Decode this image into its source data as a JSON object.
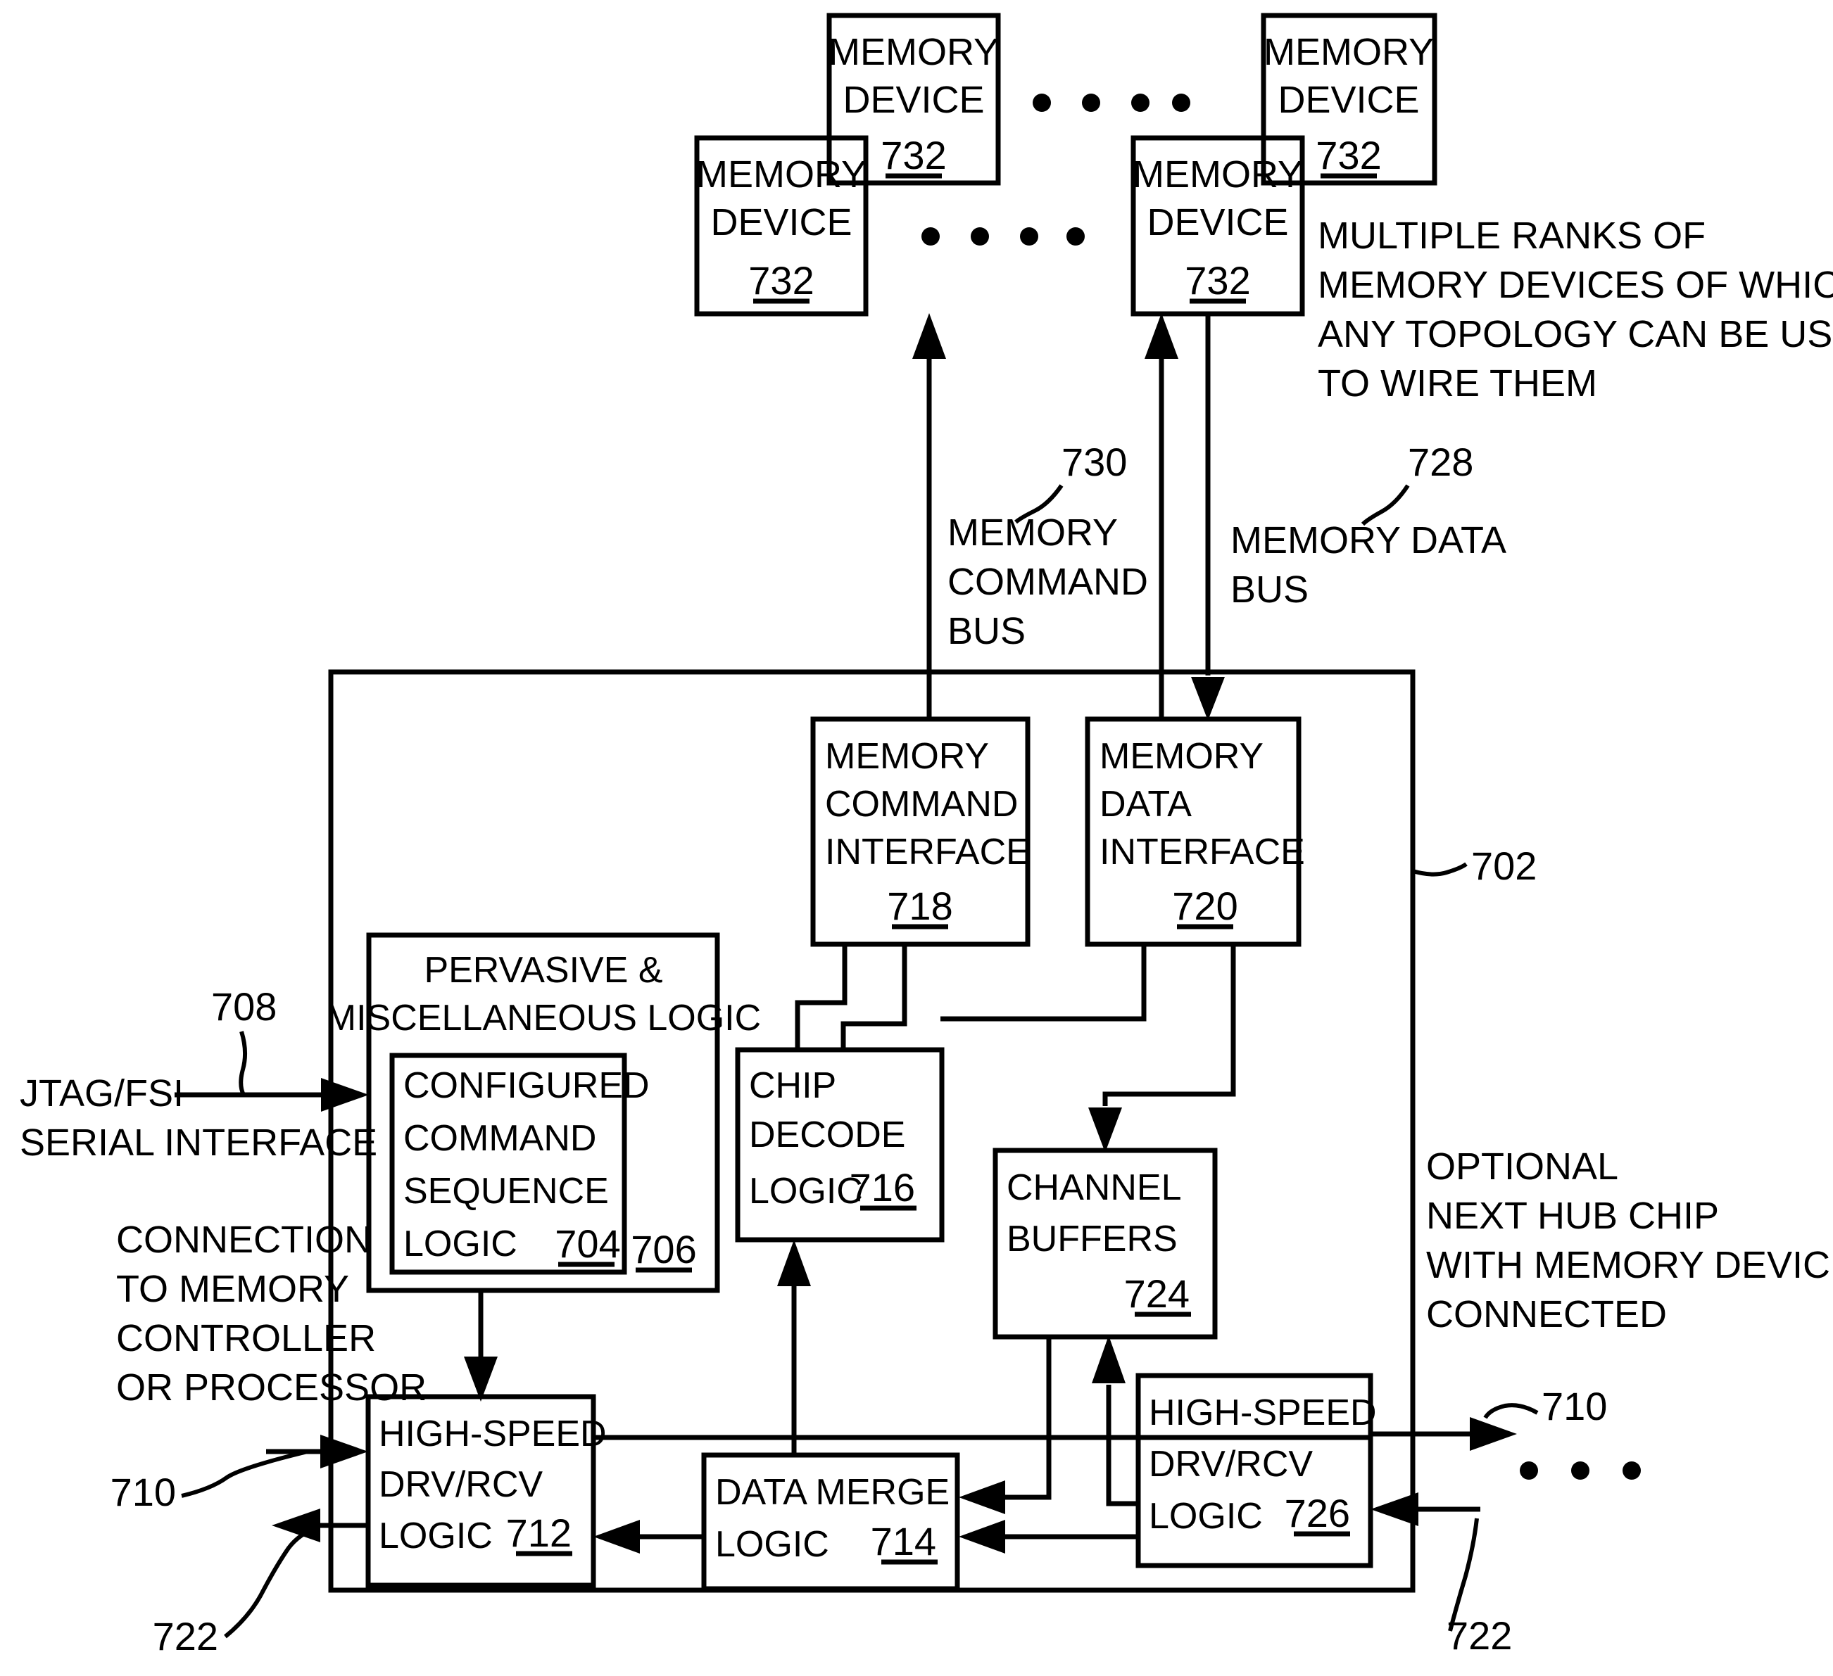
{
  "figure": {
    "type": "patent-block-diagram",
    "blocks": [
      {
        "id": "mem_dev_tl",
        "lines": [
          "MEMORY",
          "DEVICE"
        ],
        "ref": "732"
      },
      {
        "id": "mem_dev_bl",
        "lines": [
          "MEMORY",
          "DEVICE"
        ],
        "ref": "732"
      },
      {
        "id": "mem_dev_tr",
        "lines": [
          "MEMORY",
          "DEVICE"
        ],
        "ref": "732"
      },
      {
        "id": "mem_dev_br",
        "lines": [
          "MEMORY",
          "DEVICE"
        ],
        "ref": "732"
      },
      {
        "id": "mem_cmd_if",
        "lines": [
          "MEMORY",
          "COMMAND",
          "INTERFACE"
        ],
        "ref": "718"
      },
      {
        "id": "mem_data_if",
        "lines": [
          "MEMORY",
          "DATA",
          "INTERFACE"
        ],
        "ref": "720"
      },
      {
        "id": "pervasive",
        "lines": [
          "PERVASIVE &",
          "MISCELLANEOUS LOGIC"
        ],
        "ref": "706"
      },
      {
        "id": "cfg_cmd_seq",
        "lines": [
          "CONFIGURED",
          "COMMAND",
          "SEQUENCE",
          "LOGIC"
        ],
        "ref": "704"
      },
      {
        "id": "chip_decode",
        "lines": [
          "CHIP",
          "DECODE",
          "LOGIC"
        ],
        "ref": "716"
      },
      {
        "id": "channel_buf",
        "lines": [
          "CHANNEL",
          "BUFFERS"
        ],
        "ref": "724"
      },
      {
        "id": "hs_drv_left",
        "lines": [
          "HIGH-SPEED",
          "DRV/RCV",
          "LOGIC"
        ],
        "ref": "712"
      },
      {
        "id": "data_merge",
        "lines": [
          "DATA MERGE",
          "LOGIC"
        ],
        "ref": "714"
      },
      {
        "id": "hs_drv_right",
        "lines": [
          "HIGH-SPEED",
          "DRV/RCV",
          "LOGIC"
        ],
        "ref": "726"
      },
      {
        "id": "hub_chip",
        "lines": [],
        "ref": "702"
      }
    ],
    "annotations": {
      "multiple_ranks": {
        "lines": [
          "MULTIPLE RANKS OF",
          "MEMORY DEVICES OF WHICH",
          "ANY TOPOLOGY CAN BE USED",
          "TO WIRE THEM"
        ]
      },
      "memory_command_bus": {
        "lines": [
          "MEMORY",
          "COMMAND",
          "BUS"
        ],
        "ref": "730"
      },
      "memory_data_bus": {
        "lines": [
          "MEMORY DATA",
          "BUS"
        ],
        "ref": "728"
      },
      "jtag_fsi": {
        "lines": [
          "JTAG/FSI",
          "SERIAL INTERFACE"
        ],
        "ref": "708"
      },
      "connection_mc": {
        "lines": [
          "CONNECTION",
          "TO MEMORY",
          "CONTROLLER",
          "OR PROCESSOR"
        ]
      },
      "optional_next_hub": {
        "lines": [
          "OPTIONAL",
          "NEXT HUB CHIP",
          "WITH MEMORY DEVICES",
          "CONNECTED"
        ]
      },
      "ref_710_left": "710",
      "ref_722_left": "722",
      "ref_710_right": "710",
      "ref_722_right": "722",
      "ref_702": "702"
    },
    "colors": {
      "ink": "#000000",
      "paper": "#ffffff"
    }
  }
}
